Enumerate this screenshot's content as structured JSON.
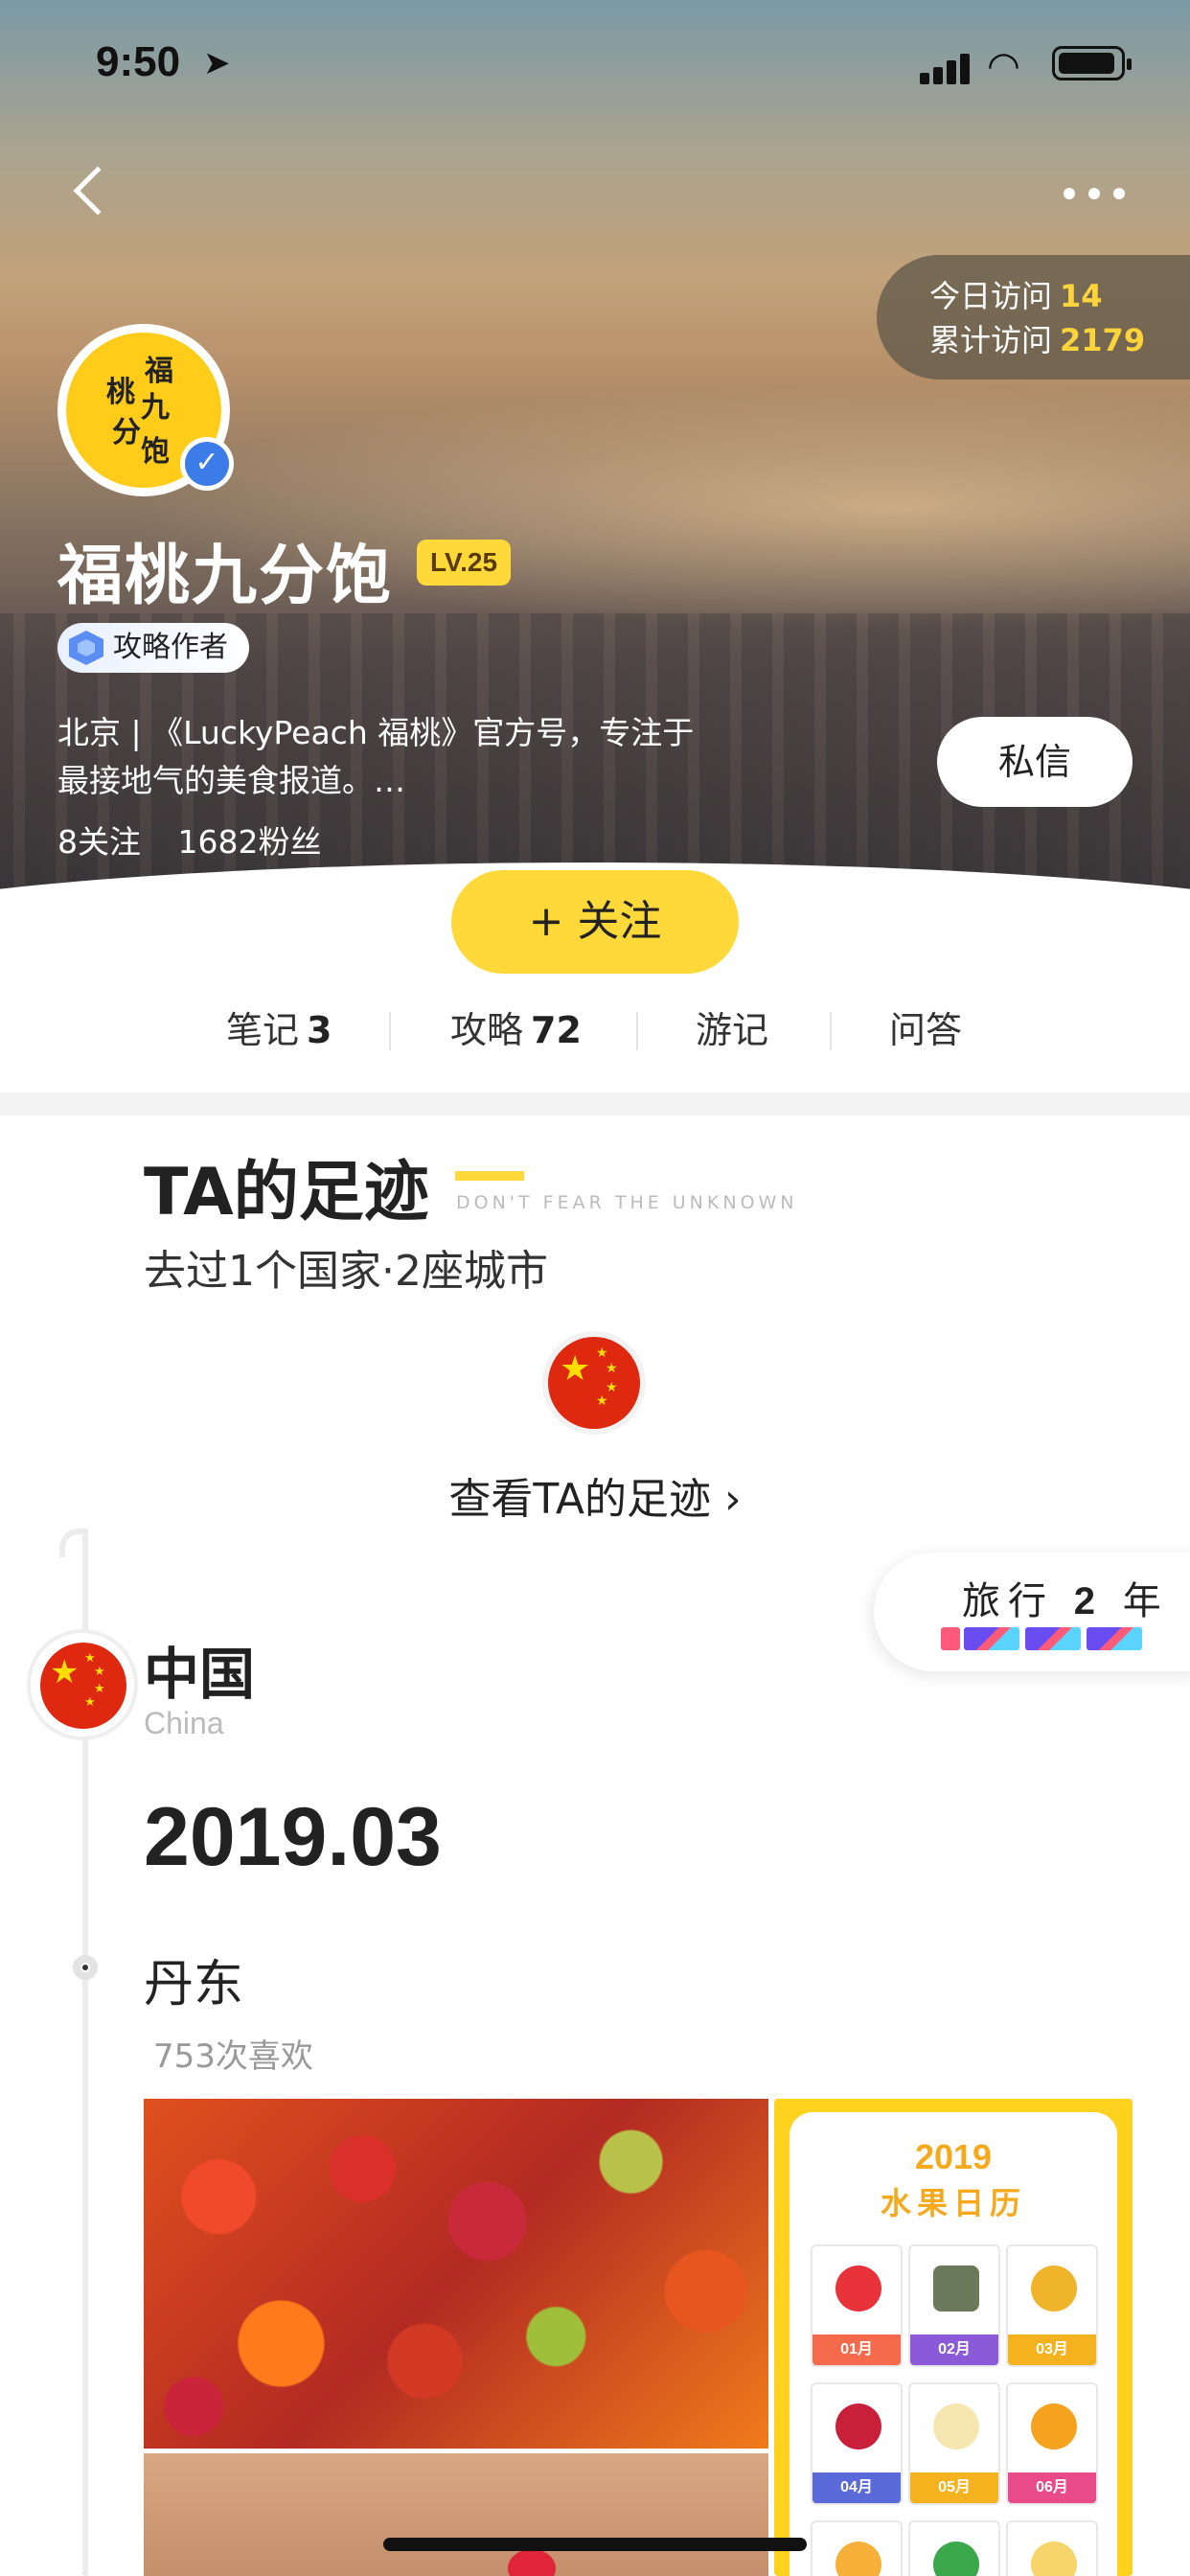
{
  "status_bar": {
    "time": "9:50",
    "location_arrow": "location-arrow-icon"
  },
  "header": {
    "visits": {
      "today_label": "今日访问",
      "today_value": "14",
      "total_label": "累计访问",
      "total_value": "2179"
    },
    "avatar_text": [
      "福",
      "桃",
      "九",
      "分",
      "饱"
    ],
    "user_name": "福桃九分饱",
    "level": "LV.25",
    "badge": "攻略作者",
    "bio_line1": "北京 | 《LuckyPeach 福桃》官方号，专注于",
    "bio_line2": "最接地气的美食报道。…",
    "following": "8关注",
    "followers": "1682粉丝",
    "message_button": "私信",
    "follow_button": "+ 关注"
  },
  "tabs": [
    {
      "label": "笔记",
      "count": "3"
    },
    {
      "label": "攻略",
      "count": "72"
    },
    {
      "label": "游记",
      "count": ""
    },
    {
      "label": "问答",
      "count": ""
    }
  ],
  "footprints": {
    "title": "TA的足迹",
    "slogan": "DON'T FEAR THE UNKNOWN",
    "subtitle": "去过1个国家·2座城市",
    "view_link": "查看TA的足迹 ›",
    "travel_prefix": "旅行",
    "travel_years": "2",
    "travel_suffix": "年",
    "country": "中国",
    "country_en": "China",
    "date": "2019.03",
    "city": "丹东",
    "likes": "753次喜欢"
  },
  "calendar": {
    "year": "2019",
    "title": "水果日历",
    "months": [
      "01月",
      "02月",
      "03月",
      "04月",
      "05月",
      "06月",
      "",
      "",
      ""
    ]
  },
  "colors": {
    "accent": "#ffd93a",
    "flag_red": "#de2910",
    "flag_star": "#ffde00"
  }
}
